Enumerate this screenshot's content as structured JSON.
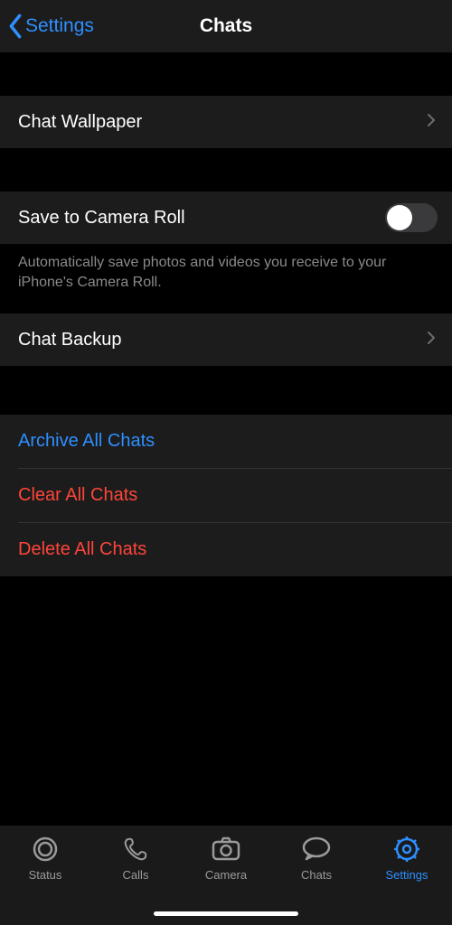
{
  "nav": {
    "back_label": "Settings",
    "title": "Chats"
  },
  "rows": {
    "wallpaper_label": "Chat Wallpaper",
    "save_camera_label": "Save to Camera Roll",
    "save_camera_footnote": "Automatically save photos and videos you receive to your iPhone's Camera Roll.",
    "save_camera_on": false,
    "backup_label": "Chat Backup",
    "archive_label": "Archive All Chats",
    "clear_label": "Clear All Chats",
    "delete_label": "Delete All Chats"
  },
  "tabs": {
    "status": "Status",
    "calls": "Calls",
    "camera": "Camera",
    "chats": "Chats",
    "settings": "Settings",
    "active": "settings"
  },
  "colors": {
    "accent": "#2e8fff",
    "destructive": "#ff4539",
    "cell_bg": "#1c1c1c"
  }
}
